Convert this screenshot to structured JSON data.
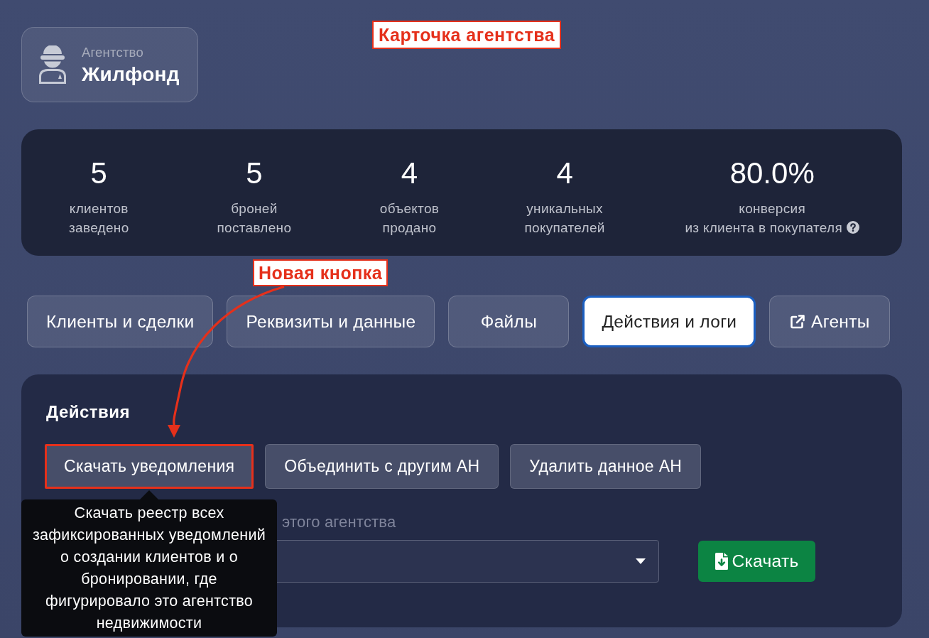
{
  "agency": {
    "label": "Агентство",
    "name": "Жилфонд"
  },
  "annotations": [
    {
      "kind": "callout",
      "text": "Карточка агентства"
    },
    {
      "kind": "arrow-callout",
      "text": "Новая кнопка"
    }
  ],
  "stats": [
    {
      "value": "5",
      "label": "клиентов\nзаведено",
      "help": false
    },
    {
      "value": "5",
      "label": "броней\nпоставлено",
      "help": false
    },
    {
      "value": "4",
      "label": "объектов\nпродано",
      "help": false
    },
    {
      "value": "4",
      "label": "уникальных\nпокупателей",
      "help": false
    },
    {
      "value": "80.0%",
      "label": "конверсия\nиз клиента в покупателя",
      "help": true
    }
  ],
  "tabs": [
    {
      "label": "Клиенты и сделки",
      "selected": false,
      "external": false
    },
    {
      "label": "Реквизиты и данные",
      "selected": false,
      "external": false
    },
    {
      "label": "Файлы",
      "selected": false,
      "external": false
    },
    {
      "label": "Действия и логи",
      "selected": true,
      "external": false
    },
    {
      "label": "Агенты",
      "selected": false,
      "external": true
    }
  ],
  "actions": {
    "title": "Действия",
    "buttons": [
      {
        "label": "Скачать уведомления",
        "highlighted": true
      },
      {
        "label": "Объединить с другим АН",
        "highlighted": false
      },
      {
        "label": "Удалить данное АН",
        "highlighted": false
      }
    ],
    "document": {
      "label": "этого агентства",
      "download_button": "Скачать"
    },
    "tooltip": "Скачать реестр всех зафиксированных уведомлений о создании клиентов и о бронировании, где фигурировало это агентство недвижимости"
  }
}
